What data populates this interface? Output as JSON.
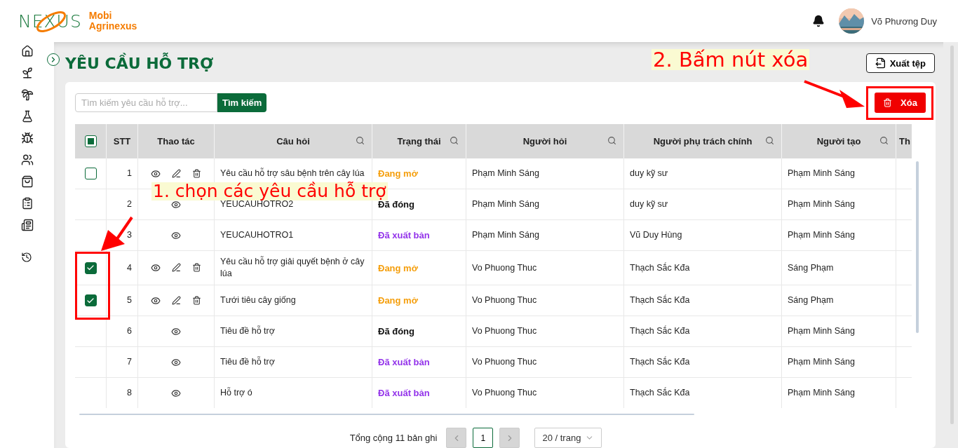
{
  "header": {
    "logo_text": "NEXUS",
    "brand_line1": "Mobi",
    "brand_line2": "Agrinexus",
    "user_name": "Võ Phương Duy"
  },
  "page": {
    "title": "YÊU CẦU HỖ TRỢ",
    "export_button": "Xuất tệp"
  },
  "toolbar": {
    "search_placeholder": "Tìm kiếm yêu cầu hỗ trợ...",
    "search_button": "Tìm kiếm",
    "delete_button": "Xóa"
  },
  "table": {
    "select_all": {
      "checked": false,
      "indeterminate": true
    },
    "columns": [
      {
        "label": "STT",
        "searchable": false
      },
      {
        "label": "Thao tác",
        "searchable": false
      },
      {
        "label": "Câu hỏi",
        "searchable": true
      },
      {
        "label": "Trạng thái",
        "searchable": true
      },
      {
        "label": "Người hỏi",
        "searchable": true
      },
      {
        "label": "Người phụ trách chính",
        "searchable": true
      },
      {
        "label": "Người tạo",
        "searchable": true
      },
      {
        "label": "Th"
      }
    ],
    "rows": [
      {
        "stt": "1",
        "selectable": true,
        "checked": false,
        "editable": true,
        "question": "Yêu cầu hỗ trợ sâu bệnh trên cây lúa",
        "status": {
          "text": "Đang mở",
          "kind": "open"
        },
        "asker": "Phạm Minh Sáng",
        "assignee": "duy kỹ sư",
        "creator": "Phạm Minh Sáng"
      },
      {
        "stt": "2",
        "selectable": false,
        "editable": false,
        "question": "YEUCAUHOTRO2",
        "status": {
          "text": "Đã đóng",
          "kind": "closed"
        },
        "asker": "Phạm Minh Sáng",
        "assignee": "duy kỹ sư",
        "creator": "Phạm Minh Sáng"
      },
      {
        "stt": "3",
        "selectable": false,
        "editable": false,
        "question": "YEUCAUHOTRO1",
        "status": {
          "text": "Đã xuất bản",
          "kind": "published"
        },
        "asker": "Phạm Minh Sáng",
        "assignee": "Vũ Duy Hùng",
        "creator": "Phạm Minh Sáng"
      },
      {
        "stt": "4",
        "selectable": true,
        "checked": true,
        "editable": true,
        "question": "Yêu cầu hỗ trợ giải quyết bệnh ở cây lúa",
        "status": {
          "text": "Đang mở",
          "kind": "open"
        },
        "asker": "Vo Phuong Thuc",
        "assignee": "Thạch Sắc Kđa",
        "creator": "Sáng Phạm"
      },
      {
        "stt": "5",
        "selectable": true,
        "checked": true,
        "editable": true,
        "question": "Tưới tiêu cây giống",
        "status": {
          "text": "Đang mở",
          "kind": "open"
        },
        "asker": "Vo Phuong Thuc",
        "assignee": "Thạch Sắc Kđa",
        "creator": "Sáng Phạm"
      },
      {
        "stt": "6",
        "selectable": false,
        "editable": false,
        "question": "Tiêu đề hỗ trợ",
        "status": {
          "text": "Đã đóng",
          "kind": "closed"
        },
        "asker": "Vo Phuong Thuc",
        "assignee": "Thạch Sắc Kđa",
        "creator": "Phạm Minh Sáng"
      },
      {
        "stt": "7",
        "selectable": false,
        "editable": false,
        "question": "Tiêu đề hỗ trợ",
        "status": {
          "text": "Đã xuất bản",
          "kind": "published"
        },
        "asker": "Vo Phuong Thuc",
        "assignee": "Thạch Sắc Kđa",
        "creator": "Phạm Minh Sáng"
      },
      {
        "stt": "8",
        "selectable": false,
        "editable": false,
        "question": "Hỗ trợ ó",
        "status": {
          "text": "Đã xuất bản",
          "kind": "published"
        },
        "asker": "Vo Phuong Thuc",
        "assignee": "Thạch Sắc Kđa",
        "creator": "Phạm Minh Sáng"
      }
    ]
  },
  "pagination": {
    "total": "Tổng cộng 11 bản ghi",
    "pages": [
      {
        "label": "1",
        "selected": true
      }
    ],
    "page_size": "20 / trang"
  },
  "annotations": [
    {
      "text": "1. chọn các yêu cầu hỗ trợ"
    },
    {
      "text": "2. Bấm nút xóa"
    }
  ]
}
